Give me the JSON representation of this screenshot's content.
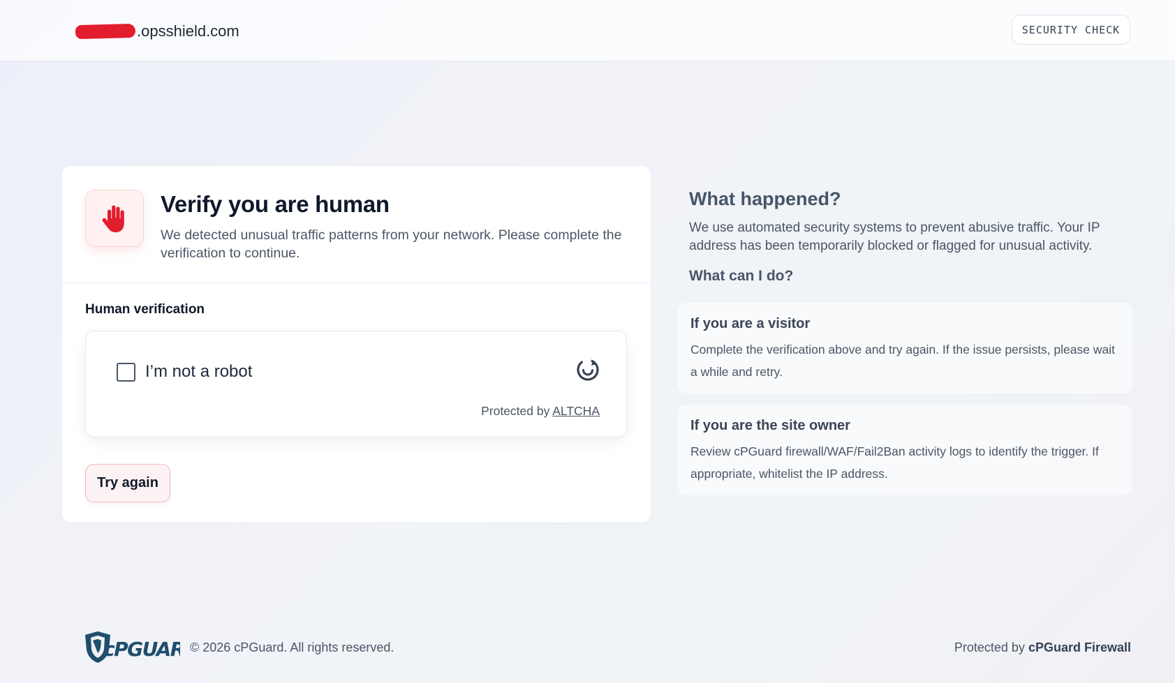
{
  "header": {
    "domain_suffix": ".opsshield.com",
    "badge": "SECURITY CHECK"
  },
  "card": {
    "title": "Verify you are human",
    "lead": "We detected unusual traffic patterns from your network. Please complete the verification to continue.",
    "section_label": "Human verification",
    "widget": {
      "checkbox_label": "I’m not a robot",
      "protected_prefix": "Protected by",
      "protected_link": "ALTCHA",
      "checked": false
    },
    "try_again": "Try again",
    "accent": "#e11d2e"
  },
  "side": {
    "title": "What happened?",
    "description": "We use automated security systems to prevent abusive traffic. Your IP address has been temporarily blocked or flagged for unusual activity.",
    "subtitle": "What can I do?",
    "cards": [
      {
        "title": "If you are a visitor",
        "text": "Complete the verification above and try again. If the issue persists, please wait a while and retry."
      },
      {
        "title": "If you are the site owner",
        "text": "Review cPGuard firewall/WAF/Fail2Ban activity logs to identify the trigger. If appropriate, whitelist the IP address."
      }
    ]
  },
  "footer": {
    "logo_text": "cPGUARD",
    "copyright": "© 2026 cPGuard. All rights reserved.",
    "protected_prefix": "Protected by",
    "protected_name": "cPGuard Firewall",
    "logo_color": "#1f4e6b"
  },
  "icons": {
    "stop": "hand-stop-icon",
    "refresh": "refresh-icon",
    "logo": "cpguard-logo"
  }
}
